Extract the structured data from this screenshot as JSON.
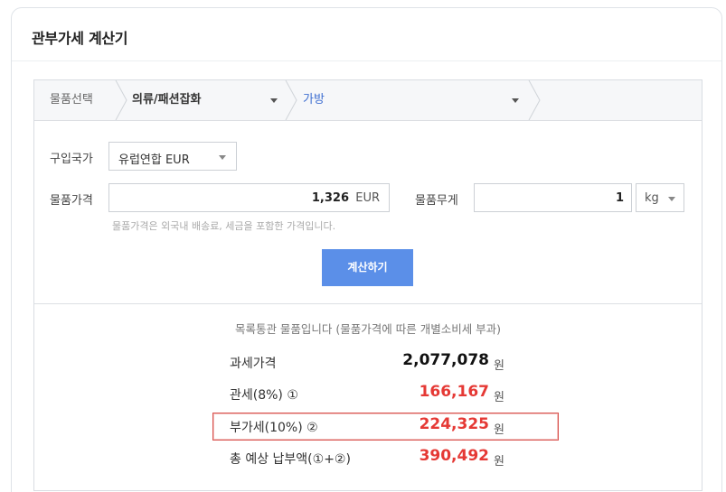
{
  "card": {
    "title": "관부가세 계산기"
  },
  "category": {
    "label": "물품선택",
    "level1": "의류/패션잡화",
    "level2": "가방"
  },
  "country": {
    "label": "구입국가",
    "value": "유럽연합 EUR"
  },
  "price": {
    "label": "물품가격",
    "value": "1,326",
    "currency": "EUR",
    "hint": "물품가격은 외국내 배송료, 세금을 포함한 가격입니다."
  },
  "weight": {
    "label": "물품무게",
    "value": "1",
    "unit": "kg"
  },
  "button": {
    "label": "계산하기"
  },
  "result": {
    "note": "목록통관 물품입니다 (물품가격에 따른 개별소비세 부과)",
    "currency_unit": "원",
    "rows": [
      {
        "label": "과세가격",
        "value": "2,077,078"
      },
      {
        "label": "관세(8%) ①",
        "value": "166,167"
      },
      {
        "label": "부가세(10%) ②",
        "value": "224,325"
      },
      {
        "label": "총 예상 납부액(①+②)",
        "value": "390,492"
      }
    ]
  },
  "colors": {
    "accent": "#5b8fe8",
    "link": "#3f6fd1",
    "result_red": "#e53935",
    "highlight": "#d9534f"
  }
}
